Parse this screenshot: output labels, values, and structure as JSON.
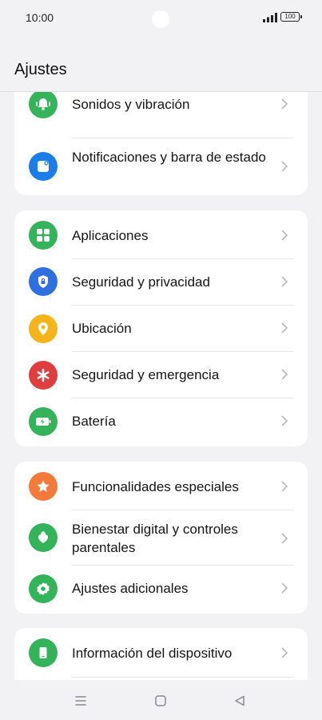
{
  "status_bar": {
    "time": "10:00",
    "battery": "100"
  },
  "header": {
    "title": "Ajustes"
  },
  "groups": [
    {
      "items": [
        {
          "label": "Sonidos y vibración",
          "icon": "bell-icon",
          "color": "#34b35a"
        },
        {
          "label": "Notificaciones y barra de estado",
          "icon": "notification-icon",
          "color": "#1a7de8"
        }
      ]
    },
    {
      "items": [
        {
          "label": "Aplicaciones",
          "icon": "apps-grid-icon",
          "color": "#34b35a"
        },
        {
          "label": "Seguridad y privacidad",
          "icon": "shield-lock-icon",
          "color": "#2f6fe0"
        },
        {
          "label": "Ubicación",
          "icon": "location-pin-icon",
          "color": "#f5b41a"
        },
        {
          "label": "Seguridad y emergencia",
          "icon": "asterisk-icon",
          "color": "#e03e3e"
        },
        {
          "label": "Batería",
          "icon": "battery-charging-icon",
          "color": "#34b35a"
        }
      ]
    },
    {
      "items": [
        {
          "label": "Funcionalidades especiales",
          "icon": "star-icon",
          "color": "#f47a3c"
        },
        {
          "label": "Bienestar digital y controles parentales",
          "icon": "wellbeing-icon",
          "color": "#34b35a"
        },
        {
          "label": "Ajustes adicionales",
          "icon": "gear-icon",
          "color": "#34b35a"
        }
      ]
    },
    {
      "items": [
        {
          "label": "Información del dispositivo",
          "icon": "device-icon",
          "color": "#34b35a"
        }
      ]
    }
  ],
  "nav": {
    "menu": "menu-icon",
    "home": "home-icon",
    "back": "back-icon"
  }
}
